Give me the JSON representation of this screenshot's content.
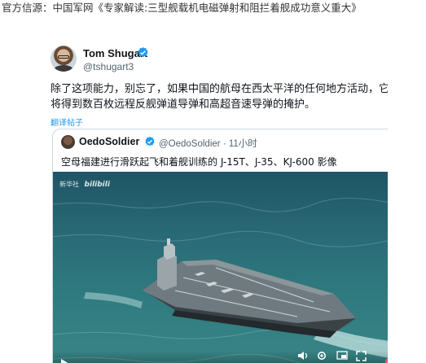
{
  "headline": "官方信源：中国军网《专家解读:三型舰载机电磁弹射和阻拦着舰成功意义重大》",
  "tweet": {
    "author_name": "Tom Shugart",
    "author_handle": "@tshugart3",
    "text_lines": [
      "除了这项能力，别忘了，如果中国的航母在西太平洋的任何地方活动，它们",
      "将得到数百枚远程反舰弹道导弹和高超音速导弹的掩护。"
    ],
    "translate_label": "翻译帖子"
  },
  "quote": {
    "author_name": "OedoSoldier",
    "author_handle": "@OedoSoldier",
    "time": "· 11小时",
    "text": "空母福建进行滑跃起飞和着舰训练的 J-15T、J-35、KJ-600 影像",
    "video": {
      "watermark_source": "新华社",
      "watermark_brand": "bilibili"
    }
  },
  "colors": {
    "link": "#1d9bf0",
    "verified": "#1d9bf0",
    "sea": "#2f7a7f",
    "accent_pink": "#e8507a"
  },
  "icons": [
    "verified-icon",
    "play-icon",
    "volume-icon",
    "settings-icon",
    "fullscreen-icon",
    "pip-icon"
  ]
}
